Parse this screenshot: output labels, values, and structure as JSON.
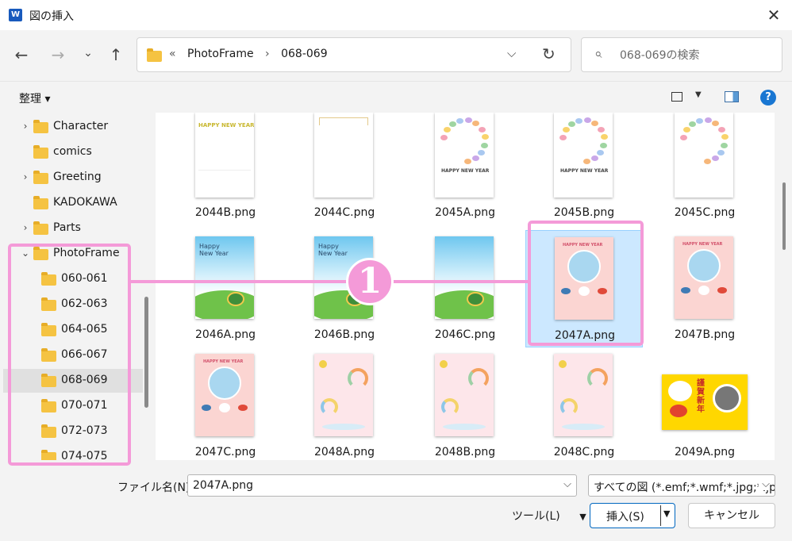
{
  "window": {
    "title": "図の挿入",
    "app_icon": "W",
    "close_glyph": "✕"
  },
  "nav": {
    "back": "←",
    "forward": "→",
    "history": "⌄",
    "up": "↑"
  },
  "address": {
    "crumbs": [
      "«",
      "PhotoFrame",
      "›",
      "068-069"
    ],
    "dropdown": "⌵",
    "refresh": "↻"
  },
  "search": {
    "placeholder": "068-069の検索",
    "icon": "⌕"
  },
  "toolbar": {
    "organize_label": "整理 ▾",
    "view_dd": "▼",
    "help": "?"
  },
  "sidebar": {
    "items": [
      {
        "label": "Character",
        "chevron": "›",
        "level": 0
      },
      {
        "label": "comics",
        "chevron": "",
        "level": 0
      },
      {
        "label": "Greeting",
        "chevron": "›",
        "level": 0
      },
      {
        "label": "KADOKAWA",
        "chevron": "",
        "level": 0
      },
      {
        "label": "Parts",
        "chevron": "›",
        "level": 0
      },
      {
        "label": "PhotoFrame",
        "chevron": "⌄",
        "level": 0
      },
      {
        "label": "060-061",
        "chevron": "",
        "level": 1
      },
      {
        "label": "062-063",
        "chevron": "",
        "level": 1
      },
      {
        "label": "064-065",
        "chevron": "",
        "level": 1
      },
      {
        "label": "066-067",
        "chevron": "",
        "level": 1
      },
      {
        "label": "068-069",
        "chevron": "",
        "level": 1,
        "selected": true
      },
      {
        "label": "070-071",
        "chevron": "",
        "level": 1
      },
      {
        "label": "072-073",
        "chevron": "",
        "level": 1
      },
      {
        "label": "074-075",
        "chevron": "",
        "level": 1
      }
    ]
  },
  "files": [
    {
      "name": "2044B.png",
      "art": "hny-white"
    },
    {
      "name": "2044C.png",
      "art": "frame-white"
    },
    {
      "name": "2045A.png",
      "art": "wreath"
    },
    {
      "name": "2045B.png",
      "art": "wreath"
    },
    {
      "name": "2045C.png",
      "art": "wreath-plain"
    },
    {
      "name": "2046A.png",
      "art": "sky-text"
    },
    {
      "name": "2046B.png",
      "art": "sky-text"
    },
    {
      "name": "2046C.png",
      "art": "sky"
    },
    {
      "name": "2047A.png",
      "art": "pink-circle",
      "selected": true
    },
    {
      "name": "2047B.png",
      "art": "pink-circle"
    },
    {
      "name": "2047C.png",
      "art": "pink-circle"
    },
    {
      "name": "2048A.png",
      "art": "rainbow"
    },
    {
      "name": "2048B.png",
      "art": "rainbow"
    },
    {
      "name": "2048C.png",
      "art": "rainbow"
    },
    {
      "name": "2049A.png",
      "art": "yellow-card"
    }
  ],
  "thumb_text": {
    "happy_new_year": "HAPPY NEW YEAR",
    "happy_new_year_mixed": "Happy\nNew Year",
    "kinga_shinnen": "謹賀新年"
  },
  "footer": {
    "filename_label": "ファイル名(N):",
    "filename_value": "2047A.png",
    "filetype_value": "すべての図 (*.emf;*.wmf;*.jpg;*.jp",
    "dd": "⌵",
    "tools_label": "ツール(L)",
    "tools_dd": "▼",
    "insert_label": "挿入(S)",
    "insert_dd": "▼",
    "cancel_label": "キャンセル"
  },
  "annotation": {
    "badge": "1"
  },
  "colors": {
    "highlight": "#f49ad8",
    "selection": "#cce8ff",
    "accent": "#0067c0",
    "folder": "#f5c342"
  }
}
